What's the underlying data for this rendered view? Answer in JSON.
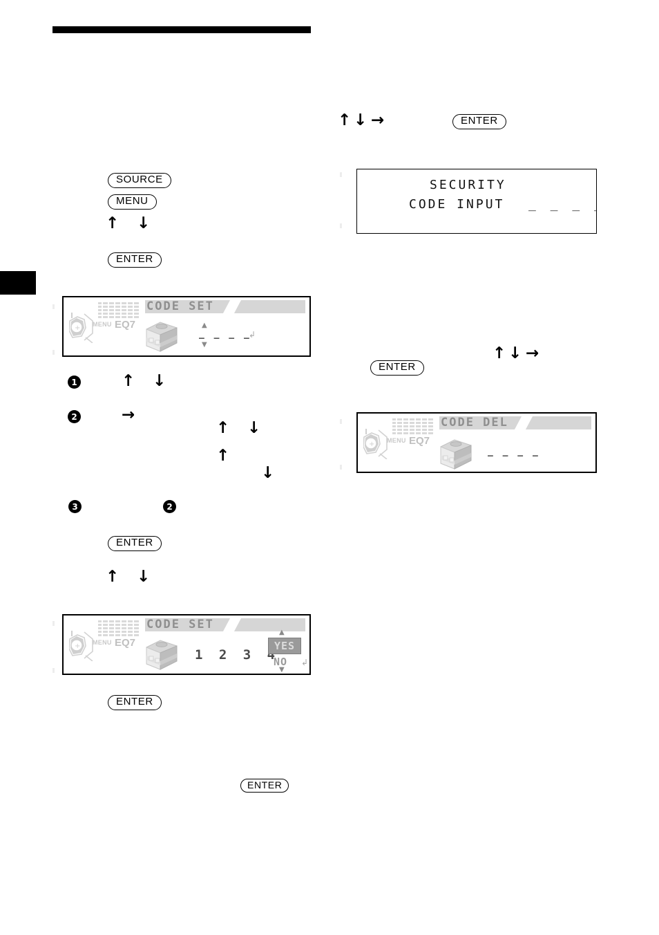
{
  "page": {
    "top_rule": "",
    "edge_tab": ""
  },
  "left_column": {
    "buttons": {
      "source": "SOURCE",
      "menu": "MENU",
      "enter_1": "ENTER",
      "enter_2": "ENTER",
      "enter_3": "ENTER",
      "enter_4": "ENTER"
    },
    "arrows": {
      "up": "↑",
      "down": "↓",
      "right": "→"
    },
    "steps": {
      "one": "1",
      "two": "2",
      "three": "3",
      "two_ref": "2"
    },
    "display_code_set_empty": {
      "title": "CODE SET",
      "menu_label": "MENU",
      "eq_label": "EQ7",
      "code_dashes": "– – – –",
      "icon": "safe-box-icon"
    },
    "display_code_set_filled": {
      "title": "CODE SET",
      "menu_label": "MENU",
      "eq_label": "EQ7",
      "digits": "1 2 3 4",
      "yes_label": "YES",
      "no_label": "NO",
      "icon": "safe-box-icon"
    }
  },
  "right_column": {
    "buttons": {
      "enter_top": "ENTER",
      "enter_mid": "ENTER"
    },
    "arrows": {
      "up": "↑",
      "down": "↓",
      "right": "→"
    },
    "display_security": {
      "line1": "SECURITY",
      "line2": "CODE INPUT",
      "code_blanks": "_ _ _ _"
    },
    "display_code_del": {
      "title": "CODE DEL",
      "menu_label": "MENU",
      "eq_label": "EQ7",
      "code_dashes": "– – – –",
      "icon": "safe-box-icon"
    }
  },
  "colors": {
    "ink": "#000000",
    "lcd_gray": "#d6d6d6",
    "lcd_text_gray": "#8f8f8f",
    "selection_gray": "#9a9a9a"
  }
}
